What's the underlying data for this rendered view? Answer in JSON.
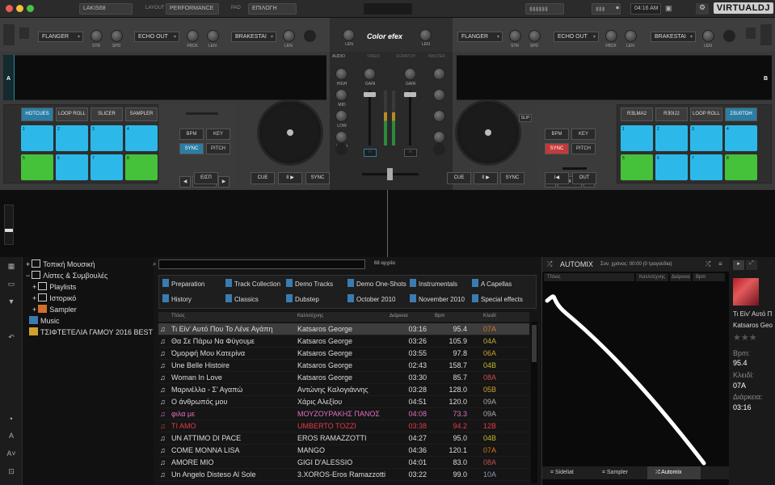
{
  "topbar": {
    "user": "LAKIS68",
    "layout_label": "LAYOUT",
    "layout_value": "PERFORMANCE",
    "mode_label": "PAD",
    "mode_value": "ΕΠΙΛΟΓΗ",
    "time": "04:16 AM",
    "logo": "VIRTUALDJ"
  },
  "deck_left": {
    "letter": "A",
    "fx1": "FLANGER",
    "fx2": "ECHO OUT",
    "fx3": "BRAKESTAI",
    "knob_labels": [
      "STR",
      "SPD",
      "FBCK",
      "LEN",
      "LEN"
    ],
    "pad_modes": [
      "HOTCUES",
      "LOOP ROLL",
      "SLICER",
      "SAMPLER"
    ],
    "pads": [
      "1",
      "2",
      "3",
      "4",
      "5",
      "6",
      "7",
      "8"
    ],
    "bpm": "BPM",
    "key": "KEY",
    "sync": "SYNC",
    "pitch": "PITCH",
    "loop_value": "4",
    "loop_btn": "ΕΙΣΠ",
    "cue": "CUE",
    "play": "II ▶",
    "sync2": "SYNC"
  },
  "deck_right": {
    "letter": "B",
    "fx1": "FLANGER",
    "fx2": "ECHO OUT",
    "fx3": "BRAKESTAI",
    "knob_labels": [
      "STR",
      "SPD",
      "FBCK",
      "LEN",
      "LEN"
    ],
    "pad_modes": [
      "RƎLMA2",
      "RƎ0IJ2",
      "LOOP ROLL",
      "2ƎU0TOH"
    ],
    "pads": [
      "1",
      "2",
      "3",
      "4",
      "5",
      "6",
      "7",
      "8"
    ],
    "bpm": "BPM",
    "key": "KEY",
    "sync": "SYNC",
    "pitch": "PITCH",
    "slip": "SLIP",
    "loop_value": "4",
    "loop_in": "I◀",
    "loop_out": "OUT",
    "cue": "CUE",
    "play": "II ▶",
    "sync2": "SYNC"
  },
  "mixer": {
    "title": "Color efex",
    "tabs": [
      "AUDIO",
      "VIDEO",
      "SCRATCH",
      "MASTER"
    ],
    "labels": [
      "HIGH",
      "MID",
      "LOW",
      "ECHO",
      "GAIN",
      "GAIN",
      "LEN",
      "LEN"
    ]
  },
  "browser": {
    "tree": [
      {
        "label": "Τοπική Μουσική",
        "indent": 0
      },
      {
        "label": "Λίστες & Συμβουλές",
        "indent": 0
      },
      {
        "label": "Playlists",
        "indent": 1
      },
      {
        "label": "Ιστορικό",
        "indent": 1
      },
      {
        "label": "Sampler",
        "indent": 1
      },
      {
        "label": "Music",
        "indent": 0
      },
      {
        "label": "ΤΣΙΦΤΕΤΕΛΙΑ ΓΑΜΟΥ 2016 BEST",
        "indent": 0
      }
    ],
    "count": "68 αρχεία",
    "folders": [
      "Preparation",
      "Track Collection",
      "Demo Tracks",
      "Demo One-Shots",
      "Instrumentals",
      "A Capellas",
      "History",
      "Classics",
      "Dubstep",
      "October 2010",
      "November 2010",
      "Special effects"
    ],
    "columns": [
      "Τίτλος",
      "Καλλιτέχνης",
      "Διάρκεια",
      "Bpm",
      "Κλειδί"
    ],
    "rows": [
      {
        "title": "Τι Είν' Αυτό Που Το Λένε Αγάπη",
        "artist": "Katsaros George",
        "dur": "03:16",
        "bpm": "95.4",
        "key": "07A",
        "kc": "#d07a20",
        "cls": "sel1"
      },
      {
        "title": "Θα Σε Πάρω Να Φύγουμε",
        "artist": "Katsaros George",
        "dur": "03:26",
        "bpm": "105.9",
        "key": "04A",
        "kc": "#b8b030",
        "cls": ""
      },
      {
        "title": "Όμορφή Μου Κατερίνα",
        "artist": "Katsaros George",
        "dur": "03:55",
        "bpm": "97.8",
        "key": "06A",
        "kc": "#d09a30",
        "cls": ""
      },
      {
        "title": "Une Belle Histoire",
        "artist": "Katsaros George",
        "dur": "02:43",
        "bpm": "158.7",
        "key": "04B",
        "kc": "#c0b830",
        "cls": ""
      },
      {
        "title": "Woman In Love",
        "artist": "Katsaros George",
        "dur": "03:30",
        "bpm": "85.7",
        "key": "08A",
        "kc": "#c05050",
        "cls": ""
      },
      {
        "title": "Μαρινέλλα - Σ' Αγαπώ",
        "artist": "Αντώνης Καλογιάννης",
        "dur": "03:28",
        "bpm": "128.0",
        "key": "05B",
        "kc": "#d0a030",
        "cls": ""
      },
      {
        "title": "Ο άνθρωπός μου",
        "artist": "Χάρις Αλεξίου",
        "dur": "04:51",
        "bpm": "120.0",
        "key": "09A",
        "kc": "#aaaaaa",
        "cls": ""
      },
      {
        "title": "φιλα με",
        "artist": "ΜΟΥΖΟΥΡΑΚΗΣ ΠΑΝΟΣ",
        "dur": "04:08",
        "bpm": "73.3",
        "key": "09A",
        "kc": "#aaaaaa",
        "cls": "pink"
      },
      {
        "title": "TI AMO",
        "artist": "UMBERTO TOZZI",
        "dur": "03:38",
        "bpm": "94.2",
        "key": "12B",
        "kc": "#40b0c0",
        "cls": "red"
      },
      {
        "title": "UN ATTIMO DI PACE",
        "artist": "EROS RAMAZZOTTI",
        "dur": "04:27",
        "bpm": "95.0",
        "key": "04B",
        "kc": "#c0b830",
        "cls": ""
      },
      {
        "title": "COME MONNA LISA",
        "artist": "MANGO",
        "dur": "04:36",
        "bpm": "120.1",
        "key": "07A",
        "kc": "#d07a20",
        "cls": ""
      },
      {
        "title": "AMORE MIO",
        "artist": "GIGI D'ALESSIO",
        "dur": "04:01",
        "bpm": "83.0",
        "key": "08A",
        "kc": "#c05050",
        "cls": ""
      },
      {
        "title": "Un Angelo Disteso Al Sole",
        "artist": "3.XOROS-Eros Ramazzotti",
        "dur": "03:22",
        "bpm": "99.0",
        "key": "10A",
        "kc": "#9090c0",
        "cls": ""
      }
    ]
  },
  "automix": {
    "title": "AUTOMIX",
    "total": "Συν. χρόνος: 00:00 (0 τραγούδια)",
    "columns": [
      "Τίτλος",
      "Καλλιτέχνης",
      "Διάρκεια",
      "Bpm"
    ],
    "tabs": [
      "Sideliat",
      "Sampler",
      "Automix"
    ]
  },
  "info": {
    "title": "Τι Είν' Αυτό Π",
    "artist": "Katsaros Geo",
    "bpm_label": "Bpm:",
    "bpm": "95.4",
    "key_label": "Κλειδί:",
    "key": "07A",
    "dur_label": "Διάρκεια:",
    "dur": "03:16"
  }
}
